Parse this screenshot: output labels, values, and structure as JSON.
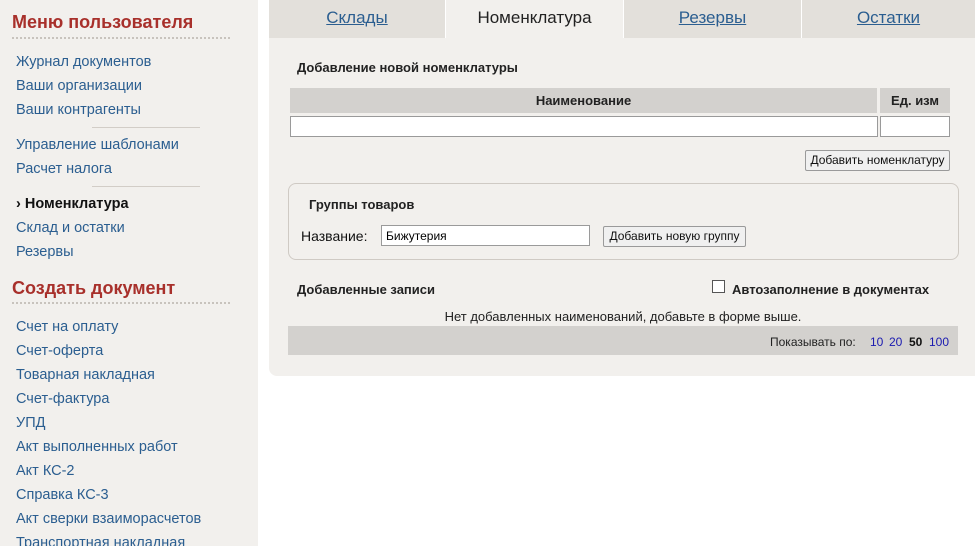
{
  "sidebar": {
    "user_menu_title": "Меню пользователя",
    "user_menu_items": [
      "Журнал документов",
      "Ваши организации",
      "Ваши контрагенты",
      "Управление шаблонами",
      "Расчет налога",
      "› Номенклатура",
      "Склад и остатки",
      "Резервы"
    ],
    "create_doc_title": "Создать документ",
    "create_doc_items": [
      "Счет на оплату",
      "Счет-оферта",
      "Товарная накладная",
      "Счет-фактура",
      "УПД",
      "Акт выполненных работ",
      "Акт КС-2",
      "Справка КС-3",
      "Акт сверки взаиморасчетов",
      "Транспортная накладная"
    ]
  },
  "tabs": [
    "Склады",
    "Номенклатура",
    "Резервы",
    "Остатки"
  ],
  "active_tab": "Номенклатура",
  "add_section": {
    "title": "Добавление новой номенклатуры",
    "col_name": "Наименование",
    "col_unit": "Ед. изм",
    "name_value": "",
    "unit_value": "",
    "add_button": "Добавить номенклатуру"
  },
  "groups": {
    "title": "Группы товаров",
    "name_label": "Название:",
    "name_value": "Бижутерия",
    "add_button": "Добавить новую группу"
  },
  "records": {
    "title": "Добавленные записи",
    "autofill_label": "Автозаполнение в документах",
    "autofill_checked": false,
    "empty_message": "Нет добавленных наименований, добавьте в форме выше.",
    "show_label": "Показывать по:",
    "page_sizes": [
      "10",
      "20",
      "50",
      "100"
    ],
    "current_page_size": "50"
  },
  "colors": {
    "heading_red": "#a8302b",
    "link_blue": "#2b5e90",
    "panel_bg": "#f2f0ed",
    "header_gray": "#d3d1ce"
  }
}
